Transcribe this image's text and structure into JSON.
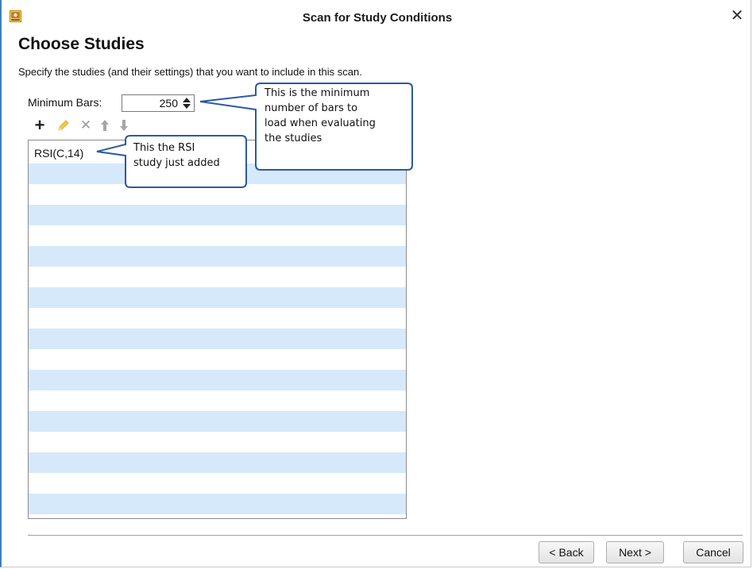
{
  "window": {
    "title": "Scan for Study Conditions",
    "close_glyph": "✕"
  },
  "page": {
    "heading": "Choose Studies",
    "description": "Specify the studies (and their settings) that you want to include in this scan."
  },
  "minimum_bars": {
    "label": "Minimum Bars:",
    "value": "250"
  },
  "toolbar": {
    "icons": [
      "plus-icon",
      "pencil-icon",
      "delete-icon",
      "arrow-up-icon",
      "arrow-down-icon"
    ],
    "add_glyph": "+",
    "delete_glyph": "✕"
  },
  "studies_list": {
    "items": [
      {
        "label": "RSI(C,14)"
      }
    ]
  },
  "callouts": {
    "minimum_bars_note": {
      "line1": "This is the minimum",
      "line2": "number of bars to",
      "line3": "load when evaluating",
      "line4": "the studies"
    },
    "rsi_note": {
      "line1": "This the RSI",
      "line2": "study just added"
    }
  },
  "buttons": {
    "back": "< Back",
    "next": "Next >",
    "cancel": "Cancel"
  },
  "colors": {
    "row_alt": "#d6e9fb",
    "callout_border": "#2c5aa0",
    "window_border": "#3f7fbf"
  }
}
